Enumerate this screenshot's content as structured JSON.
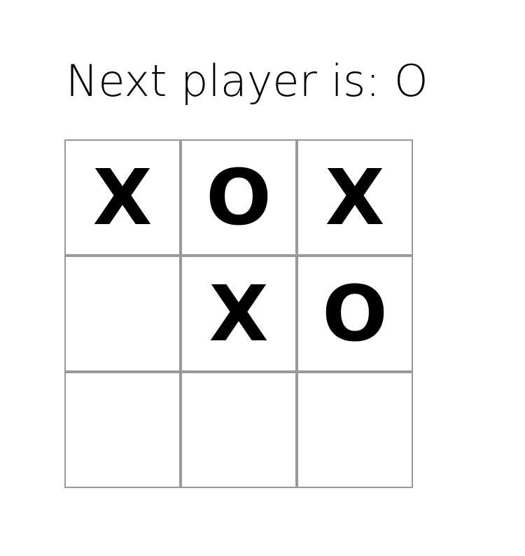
{
  "status": {
    "text": "Next player is: O"
  },
  "board": {
    "squares": [
      "X",
      "O",
      "X",
      "",
      "X",
      "O",
      "",
      "",
      ""
    ]
  },
  "colors": {
    "border": "#999999",
    "background": "#ffffff",
    "text": "#000000"
  }
}
